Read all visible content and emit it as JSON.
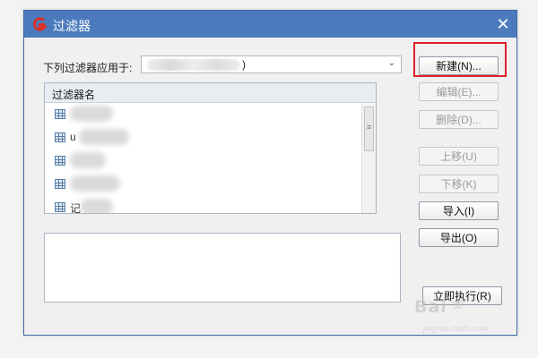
{
  "window": {
    "title": "过滤器",
    "close_symbol": "✕"
  },
  "apply_to": {
    "label": "下列过滤器应用于:",
    "value": ")"
  },
  "list": {
    "header": "过滤器名",
    "rows": [
      {
        "text": ""
      },
      {
        "text": "u"
      },
      {
        "text": ""
      },
      {
        "text": ""
      },
      {
        "text": "记"
      }
    ]
  },
  "buttons": {
    "new": "新建(N)...",
    "edit": "编辑(E)...",
    "delete": "删除(D)...",
    "move_up": "上移(U)",
    "move_down": "下移(K)",
    "import": "导入(I)",
    "export": "导出(O)",
    "run_now": "立即执行(R)"
  },
  "watermark": {
    "brand": "Bai",
    "sub": "jingyan.baidu.com"
  },
  "colors": {
    "titlebar": "#4b7bbc",
    "highlight": "#e0202a",
    "app_icon": "#d9302b"
  },
  "icons": {
    "app": "app-logo-icon",
    "close": "close-icon",
    "row": "table-icon",
    "dropdown": "chevron-down-icon"
  }
}
